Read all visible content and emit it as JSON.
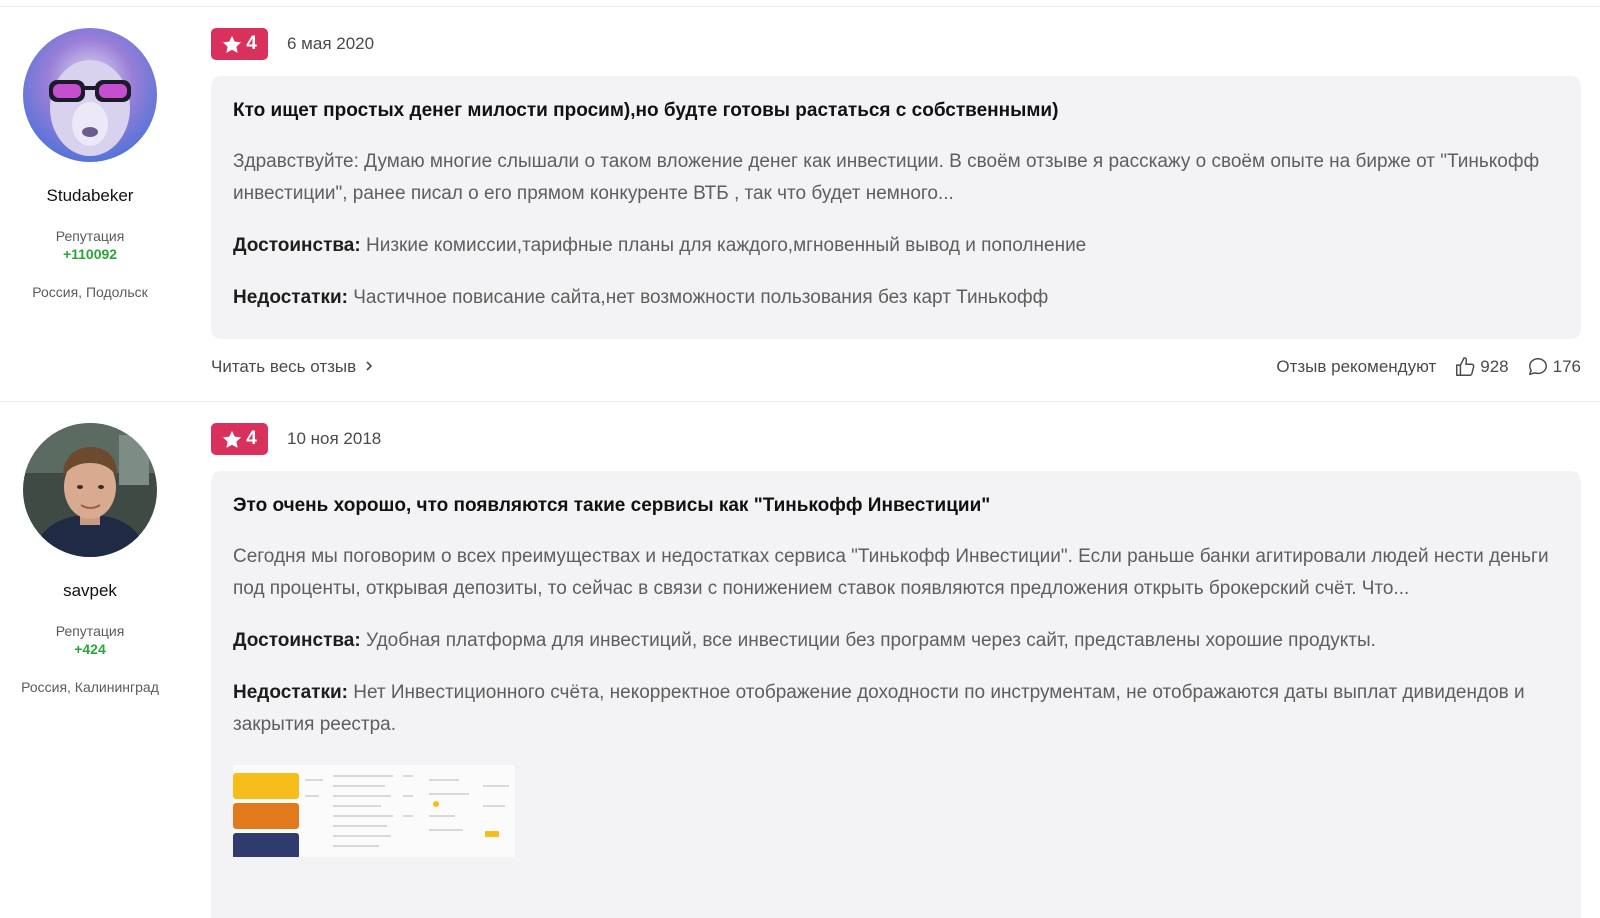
{
  "reviews": [
    {
      "author": "Studabeker",
      "reputation_label": "Репутация",
      "reputation_value": "+110092",
      "location": "Россия, Подольск",
      "rating": "4",
      "date": "6 мая 2020",
      "title": "Кто ищет простых денег милости просим),но будте готовы растаться с собственными)",
      "body": "Здравствуйте: Думаю многие слышали о таком вложение денег как инвестиции. В своём отзыве я расскажу о своём опыте на бирже от \"Тинькофф инвестиции\", ранее писал о его прямом конкуренте ВТБ , так что будет немного...",
      "pros_label": "Достоинства:",
      "pros": "Низкие комиссии,тарифные планы для каждого,мгновенный вывод и пополнение",
      "cons_label": "Недостатки:",
      "cons": "Частичное повисание сайта,нет возможности пользования без карт Тинькофф",
      "read_more": "Читать весь отзыв",
      "recommend_label": "Отзыв рекомендуют",
      "likes": "928",
      "comments": "176"
    },
    {
      "author": "savpek",
      "reputation_label": "Репутация",
      "reputation_value": "+424",
      "location": "Россия, Калининград",
      "rating": "4",
      "date": "10 ноя 2018",
      "title": "Это очень хорошо, что появляются такие сервисы как \"Тинькофф Инвестиции\"",
      "body": "Сегодня мы поговорим о всех преимуществах и недостатках сервиса \"Тинькофф Инвестиции\". Если раньше банки агитировали людей нести деньги под проценты, открывая депозиты, то сейчас в связи с понижением ставок появляются предложения открыть брокерский счёт. Что...",
      "pros_label": "Достоинства:",
      "pros": "Удобная платформа для инвестиций, все инвестиции без программ через сайт, представлены хорошие продукты.",
      "cons_label": "Недостатки:",
      "cons": "Нет Инвестиционного счёта, некорректное отображение доходности по инструментам, не отображаются даты выплат дивидендов и закрытия реестра."
    }
  ],
  "colors": {
    "rating_badge": "#d8315b",
    "reputation": "#2aa53a",
    "card_bg": "#f3f3f5"
  },
  "icons": [
    "star-icon",
    "chevron-right-icon",
    "thumbs-up-icon",
    "comment-icon"
  ]
}
